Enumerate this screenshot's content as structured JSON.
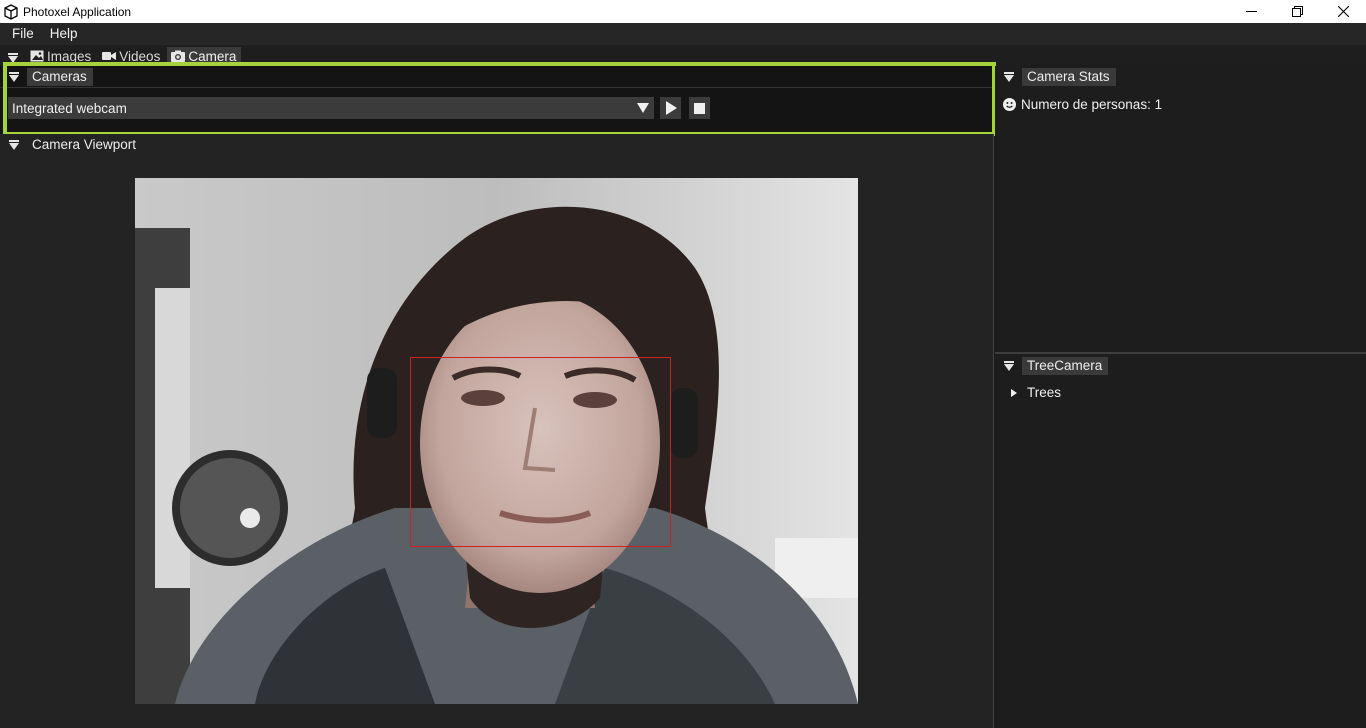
{
  "window": {
    "title": "Photoxel Application",
    "app_icon": "cube-icon"
  },
  "menu": [
    "File",
    "Help"
  ],
  "tabs": [
    {
      "label": "Images",
      "icon": "image-icon"
    },
    {
      "label": "Videos",
      "icon": "video-icon"
    },
    {
      "label": "Camera",
      "icon": "camera-icon",
      "active": true
    }
  ],
  "cameras_panel": {
    "title": "Cameras",
    "selected_camera": "Integrated webcam"
  },
  "viewport_panel": {
    "title": "Camera Viewport"
  },
  "stats_panel": {
    "title": "Camera Stats",
    "people_count_text": "Numero de personas: 1",
    "icon": "smiley-icon"
  },
  "tree_panel": {
    "title": "TreeCamera",
    "items": [
      "Trees"
    ]
  },
  "colors": {
    "highlight": "#a6d33a",
    "detection_box": "#d12020"
  }
}
